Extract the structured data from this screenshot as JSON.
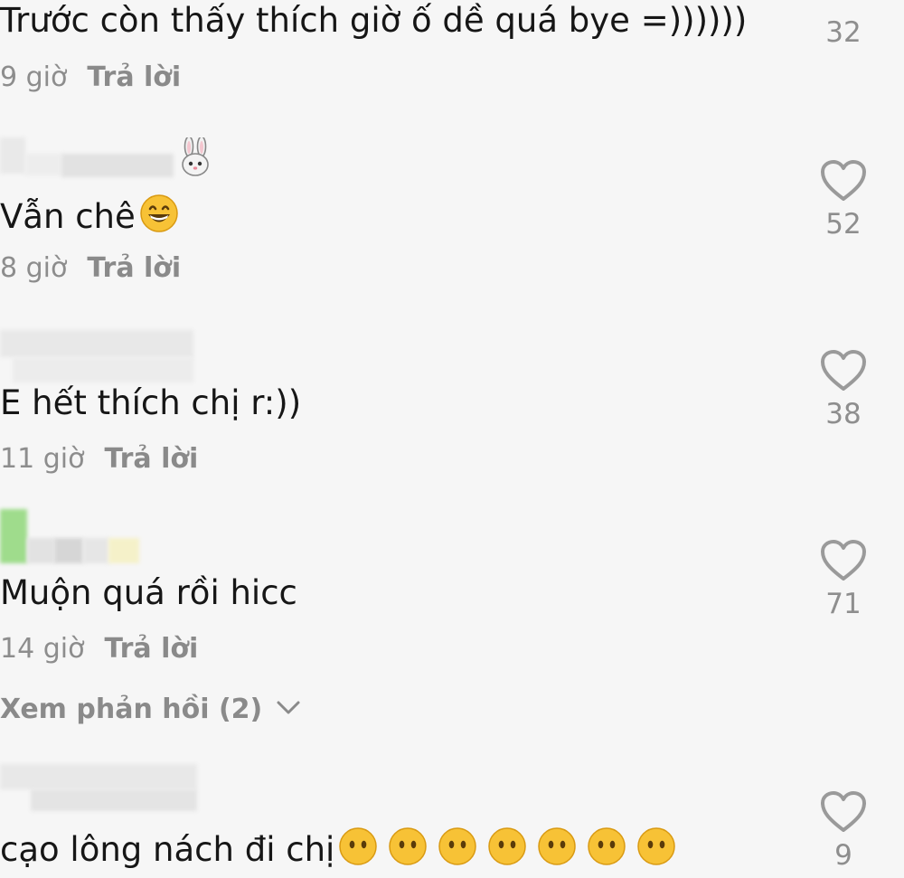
{
  "comments": [
    {
      "text": "Trước còn thấy thích giờ ố dề quá bye =))))))",
      "time": "9 giờ",
      "reply": "Trả lời",
      "likes": "32"
    },
    {
      "text": "Vẫn chê",
      "emoji": "grinning-face",
      "time": "8 giờ",
      "reply": "Trả lời",
      "likes": "52",
      "username_badge_emoji": "rabbit-face"
    },
    {
      "text": "E hết thích chị r:))",
      "time": "11 giờ",
      "reply": "Trả lời",
      "likes": "38"
    },
    {
      "text": "Muộn quá rồi hicc",
      "time": "14 giờ",
      "reply": "Trả lời",
      "likes": "71",
      "view_replies": "Xem phản hồi (2)"
    },
    {
      "text": "cạo lông nách đi chị",
      "emoji": "face-without-mouth",
      "emoji_count": 7,
      "likes": "9"
    }
  ],
  "colors": {
    "background": "#f6f6f6",
    "text": "#161616",
    "meta": "#8d8d8d",
    "heart": "#9a9a9a",
    "emoji_yellow": "#f7c236"
  }
}
